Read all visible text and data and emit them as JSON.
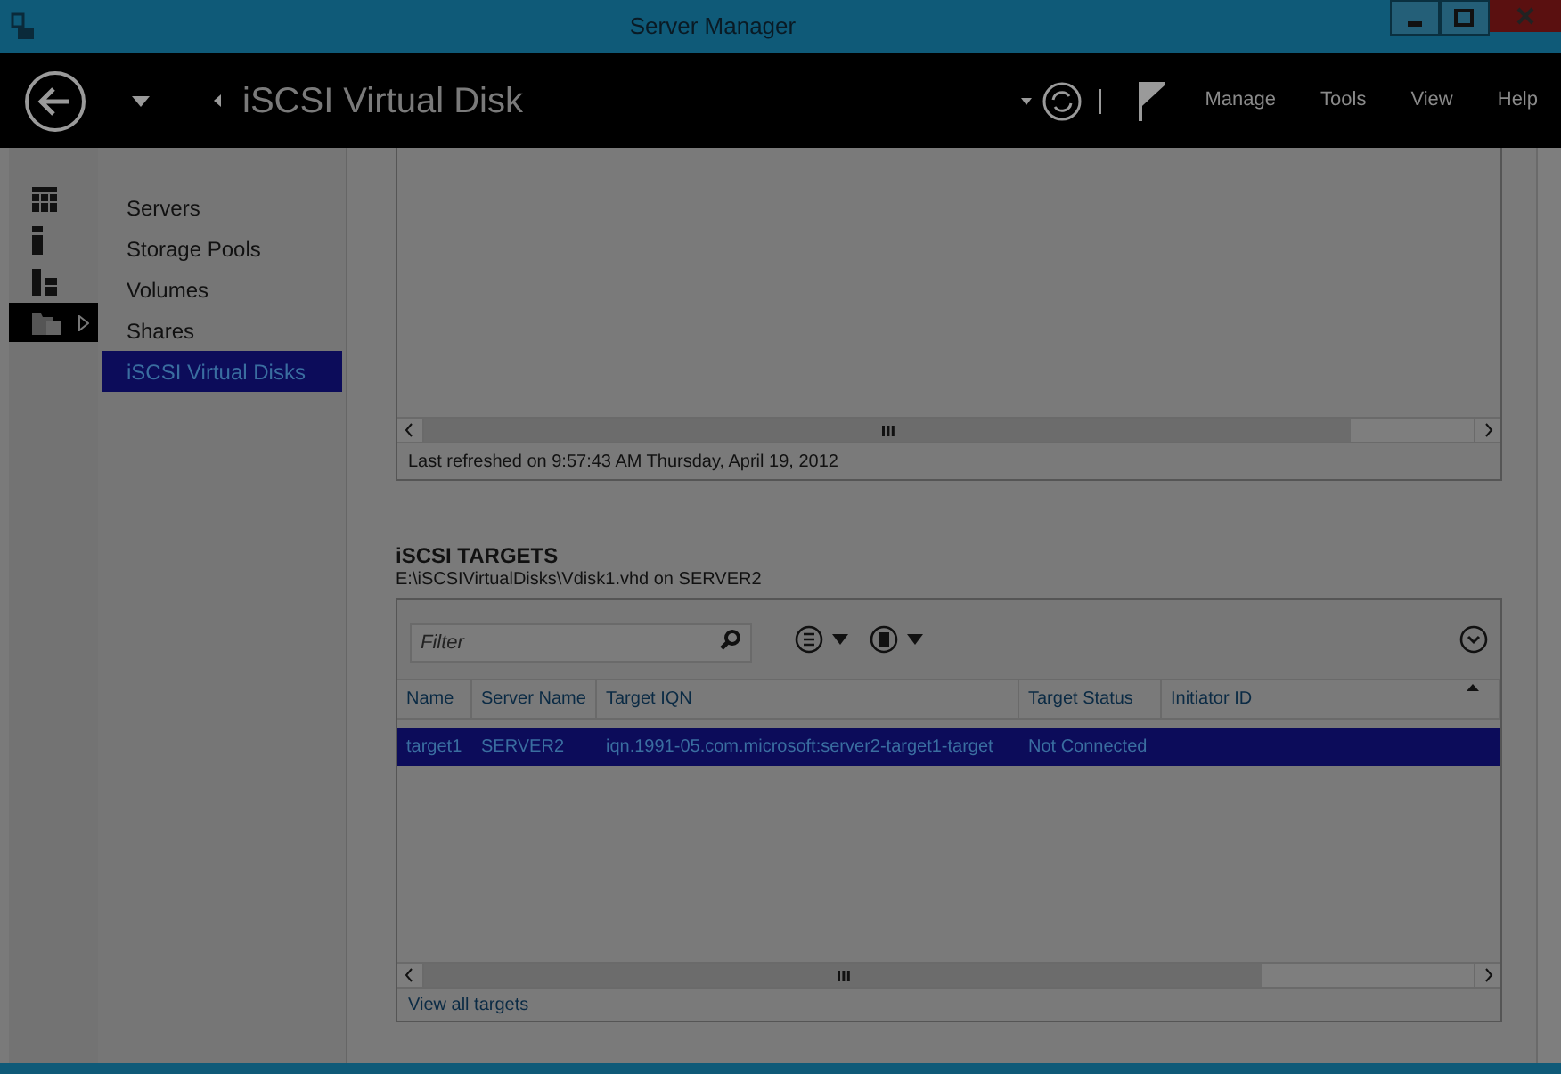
{
  "window": {
    "title": "Server Manager"
  },
  "header": {
    "breadcrumb": "iSCSI Virtual Disk",
    "menu": [
      "Manage",
      "Tools",
      "View",
      "Help"
    ]
  },
  "nav_icons": [
    {
      "kind": "dashboard",
      "selected": false
    },
    {
      "kind": "server",
      "selected": false
    },
    {
      "kind": "servers",
      "selected": false
    },
    {
      "kind": "files",
      "selected": true
    }
  ],
  "sidebar": {
    "items": [
      {
        "label": "Servers",
        "selected": false
      },
      {
        "label": "Storage Pools",
        "selected": false
      },
      {
        "label": "Volumes",
        "selected": false
      },
      {
        "label": "Shares",
        "selected": false
      },
      {
        "label": "iSCSI Virtual Disks",
        "selected": true
      }
    ]
  },
  "disks_panel": {
    "status": "Last refreshed on 9:57:43 AM Thursday, April 19, 2012"
  },
  "targets": {
    "title": "iSCSI TARGETS",
    "subtitle": "E:\\iSCSIVirtualDisks\\Vdisk1.vhd on SERVER2",
    "filter": {
      "placeholder": "Filter"
    },
    "columns": [
      "Name",
      "Server Name",
      "Target IQN",
      "Target Status",
      "Initiator ID"
    ],
    "rows": [
      {
        "cells": [
          "target1",
          "SERVER2",
          "iqn.1991-05.com.microsoft:server2-target1-target",
          "Not Connected",
          ""
        ],
        "selected": true
      }
    ],
    "link": "View all targets"
  }
}
